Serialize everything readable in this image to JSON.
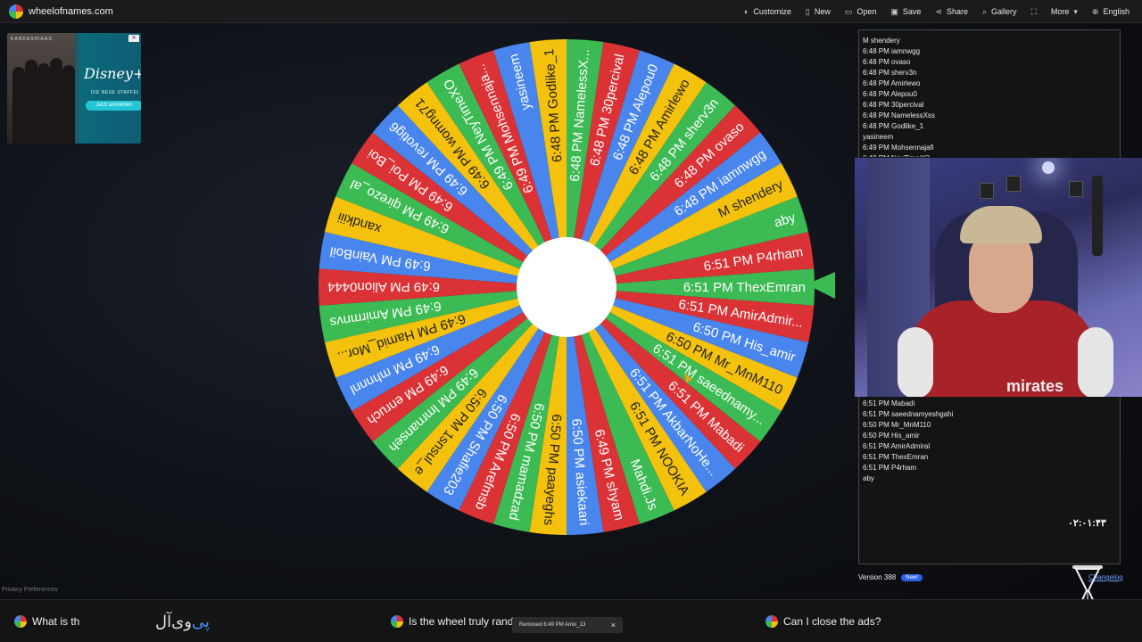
{
  "site": {
    "name": "wheelofnames.com"
  },
  "menu": [
    {
      "label": "Customize",
      "icon": "palette-icon",
      "glyph": "◐"
    },
    {
      "label": "New",
      "icon": "file-icon",
      "glyph": "▯"
    },
    {
      "label": "Open",
      "icon": "folder-icon",
      "glyph": "▭"
    },
    {
      "label": "Save",
      "icon": "save-icon",
      "glyph": "▣"
    },
    {
      "label": "Share",
      "icon": "share-icon",
      "glyph": "⋖"
    },
    {
      "label": "Gallery",
      "icon": "search-icon",
      "glyph": "⌕"
    },
    {
      "label": "",
      "icon": "fullscreen-icon",
      "glyph": "⛶"
    },
    {
      "label": "More",
      "icon": "chevron-down-icon",
      "glyph": "▾"
    },
    {
      "label": "English",
      "icon": "globe-icon",
      "glyph": "⊕"
    }
  ],
  "ad": {
    "people_label": "KARDASHIANS",
    "brand": "Disney+",
    "subtitle": "DIE NEUE STAFFEL",
    "cta": "Jetzt anmelden"
  },
  "privacy": "Privacy Preferences",
  "colors": {
    "red": "#db3236",
    "blue": "#4885ed",
    "green": "#3cba54",
    "yellow": "#f4c20d",
    "pointer": "#3cba54"
  },
  "wheel": {
    "segments": [
      "6:51 PM ThexEmran",
      "6:51 PM AmirAdmir...",
      "6:50 PM His_amir",
      "6:50 PM Mr_MnM110",
      "6:51 PM saeednamy...",
      "6:51 PM Mabadi",
      "6:51 PM AkbarNoHe...",
      "6:51 PM NOOKIA",
      "Mahdi.Js",
      "6:49 PM shyam",
      "6:50 PM asiekaari",
      "6:50 PM paayeghs",
      "6:50 PM mamadzad",
      "6:50 PM Arefmsb",
      "6:50 PM Shafie203",
      "6:50 PM 1snsul_e",
      "6:49 PM lmrnanseh",
      "6:49 PM enruch",
      "6:49 PM mhnnnl",
      "6:49 PM Hamid_Mor...",
      "6:49 PM Amirmnvs",
      "6:49 PM Alion0444",
      "6:49 PM VainBoil",
      "xandkiii",
      "6:49 PM qirezo_al",
      "6:49 PM Poi_Boi",
      "6:49 PM revotig6",
      "6:49 PM womng71",
      "6:49 PM NeyTimeXO",
      "6:49 PM Mohsennaja...",
      "yasineem",
      "6:48 PM Godlike_1",
      "6:48 PM NamelessX...",
      "6:48 PM 30percival",
      "6:48 PM Alepou0",
      "6:48 PM Amirlewo",
      "6:48 PM sherv3n",
      "6:48 PM ovaso",
      "6:48 PM iamnwgg",
      "M shendery",
      "aby",
      "6:51 PM P4rham"
    ]
  },
  "entries_top": [
    "M shendery",
    "6:48 PM iamnwgg",
    "6:48 PM ovaso",
    "6:48 PM sherv3n",
    "6:48 PM Amirlewo",
    "6:48 PM Alepou0",
    "6:48 PM 30percival",
    "6:48 PM NamelessXss",
    "6:48 PM Godlike_1",
    "yasineem",
    "6:49 PM Mohsennajafi",
    "6:49 PM NeyTimeXO"
  ],
  "entries_bottom": [
    "6:51 PM Mabadi",
    "6:51 PM saeednamyeshgahi",
    "6:50 PM Mr_MnM110",
    "6:50 PM His_amir",
    "6:51 PM AmirAdmiral",
    "6:51 PM ThexEmran",
    "6:51 PM P4rham",
    "aby"
  ],
  "timer": "۰۲:۰۱:۴۳",
  "version": {
    "label": "Version 388",
    "badge": "New!",
    "changelog": "Changelog"
  },
  "webcam": {
    "sponsor": "mirates"
  },
  "faq": [
    {
      "label": "What is th"
    },
    {
      "label": "Is the wheel truly rand"
    },
    {
      "label": "Can I close the ads?"
    }
  ],
  "overlay": {
    "prefix": "آل",
    "mid": "وی",
    "accent": "پی"
  },
  "toast": {
    "text": "Removed 6:49 PM Amix_13",
    "close": "×"
  }
}
